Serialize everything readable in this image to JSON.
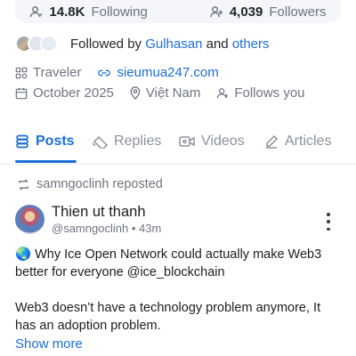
{
  "stats": {
    "following_count": "14.8K",
    "following_label": "Following",
    "followers_count": "4,039",
    "followers_label": "Followers"
  },
  "followed_by": {
    "prefix": "Followed by",
    "name": "Gulhasan",
    "joiner": "and",
    "others": "others"
  },
  "profile_meta": {
    "occupation": "Traveler",
    "website": "sieumua247.com",
    "joined": "October 2025",
    "location": "Việt Nam",
    "follows_you": "Follows you"
  },
  "tabs": [
    {
      "label": "Posts",
      "active": true
    },
    {
      "label": "Replies",
      "active": false
    },
    {
      "label": "Videos",
      "active": false
    },
    {
      "label": "Articles",
      "active": false
    }
  ],
  "post": {
    "repost_text": "samngoclinh reposted",
    "author_name": "Thien ut thanh",
    "author_handle": "@samngoclinh",
    "separator": "•",
    "time": "43m",
    "body_line1": "🌏 Why Ice Open Network could actually make Web3 better for everyone @ice_blockchain",
    "body_line2": "Web3 doesn’t have a technology problem anymore, It has an adoption problem.",
    "show_more": "Show more"
  },
  "colors": {
    "accent": "#1a6fd6",
    "muted_text": "#6e7480",
    "primary_text": "#1b1d21"
  }
}
